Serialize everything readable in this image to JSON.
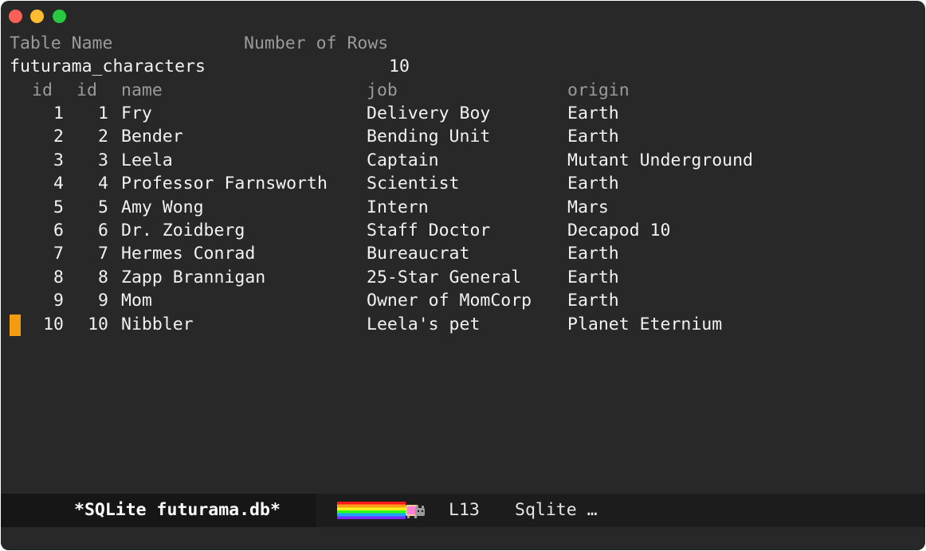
{
  "window": {
    "buttons": [
      "close",
      "minimize",
      "zoom"
    ],
    "colors": {
      "background": "#282828",
      "cursor": "#f39c12"
    }
  },
  "summary": {
    "headers": {
      "table_name": "Table Name",
      "row_count": "Number of Rows"
    },
    "table_name": "futurama_characters",
    "row_count": "10"
  },
  "table": {
    "columns": [
      "id",
      "id",
      "name",
      "job",
      "origin"
    ],
    "rows": [
      [
        "1",
        "1",
        "Fry",
        "Delivery Boy",
        "Earth"
      ],
      [
        "2",
        "2",
        "Bender",
        "Bending Unit",
        "Earth"
      ],
      [
        "3",
        "3",
        "Leela",
        "Captain",
        "Mutant Underground"
      ],
      [
        "4",
        "4",
        "Professor Farnsworth",
        "Scientist",
        "Earth"
      ],
      [
        "5",
        "5",
        "Amy Wong",
        "Intern",
        "Mars"
      ],
      [
        "6",
        "6",
        "Dr. Zoidberg",
        "Staff Doctor",
        "Decapod 10"
      ],
      [
        "7",
        "7",
        "Hermes Conrad",
        "Bureaucrat",
        "Earth"
      ],
      [
        "8",
        "8",
        "Zapp Brannigan",
        "25-Star General",
        "Earth"
      ],
      [
        "9",
        "9",
        "Mom",
        "Owner of MomCorp",
        "Earth"
      ],
      [
        "10",
        "10",
        "Nibbler",
        "Leela's pet",
        "Planet Eternium"
      ]
    ]
  },
  "modeline": {
    "buffer_name": "*SQLite futurama.db*",
    "line": "L13",
    "mode": "Sqlite …",
    "nyan_icon": "nyan-cat-progress-icon"
  }
}
